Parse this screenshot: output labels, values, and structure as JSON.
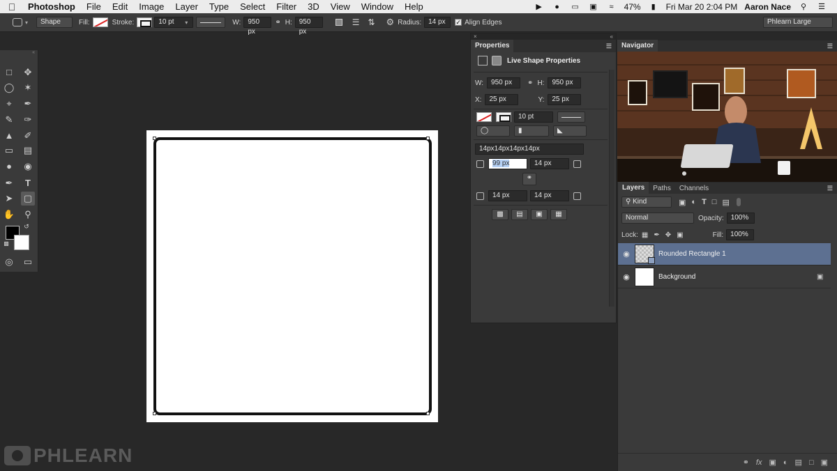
{
  "menubar": {
    "app": "Photoshop",
    "items": [
      "File",
      "Edit",
      "Image",
      "Layer",
      "Type",
      "Select",
      "Filter",
      "3D",
      "View",
      "Window",
      "Help"
    ],
    "battery": "47%",
    "datetime": "Fri Mar 20  2:04 PM",
    "user": "Aaron Nace"
  },
  "options": {
    "mode": "Shape",
    "fill_label": "Fill:",
    "stroke_label": "Stroke:",
    "stroke_width": "10 pt",
    "w_label": "W:",
    "w_value": "950 px",
    "h_label": "H:",
    "h_value": "950 px",
    "radius_label": "Radius:",
    "radius_value": "14 px",
    "align_edges": "Align Edges",
    "workspace": "Phlearn Large"
  },
  "properties": {
    "tab": "Properties",
    "heading": "Live Shape Properties",
    "w_label": "W:",
    "w": "950 px",
    "h_label": "H:",
    "h": "950 px",
    "x_label": "X:",
    "x": "25 px",
    "y_label": "Y:",
    "y": "25 px",
    "stroke_width": "10 pt",
    "corner_summary": "14px14px14px14px",
    "corner_tl": "99 px",
    "corner_tr": "14 px",
    "corner_bl": "14 px",
    "corner_br": "14 px"
  },
  "navigator": {
    "tab": "Navigator"
  },
  "layers": {
    "tabs": [
      "Layers",
      "Paths",
      "Channels"
    ],
    "filter": "Kind",
    "blend_mode": "Normal",
    "opacity_label": "Opacity:",
    "opacity": "100%",
    "lock_label": "Lock:",
    "fill_label": "Fill:",
    "fill": "100%",
    "items": [
      {
        "name": "Rounded Rectangle 1",
        "selected": true
      },
      {
        "name": "Background",
        "locked": true
      }
    ]
  },
  "watermark": "PHLEARN",
  "colors": {
    "accent_selected_layer": "#5d7091",
    "panel_bg": "#3a3a3a",
    "app_bg": "#282828"
  }
}
